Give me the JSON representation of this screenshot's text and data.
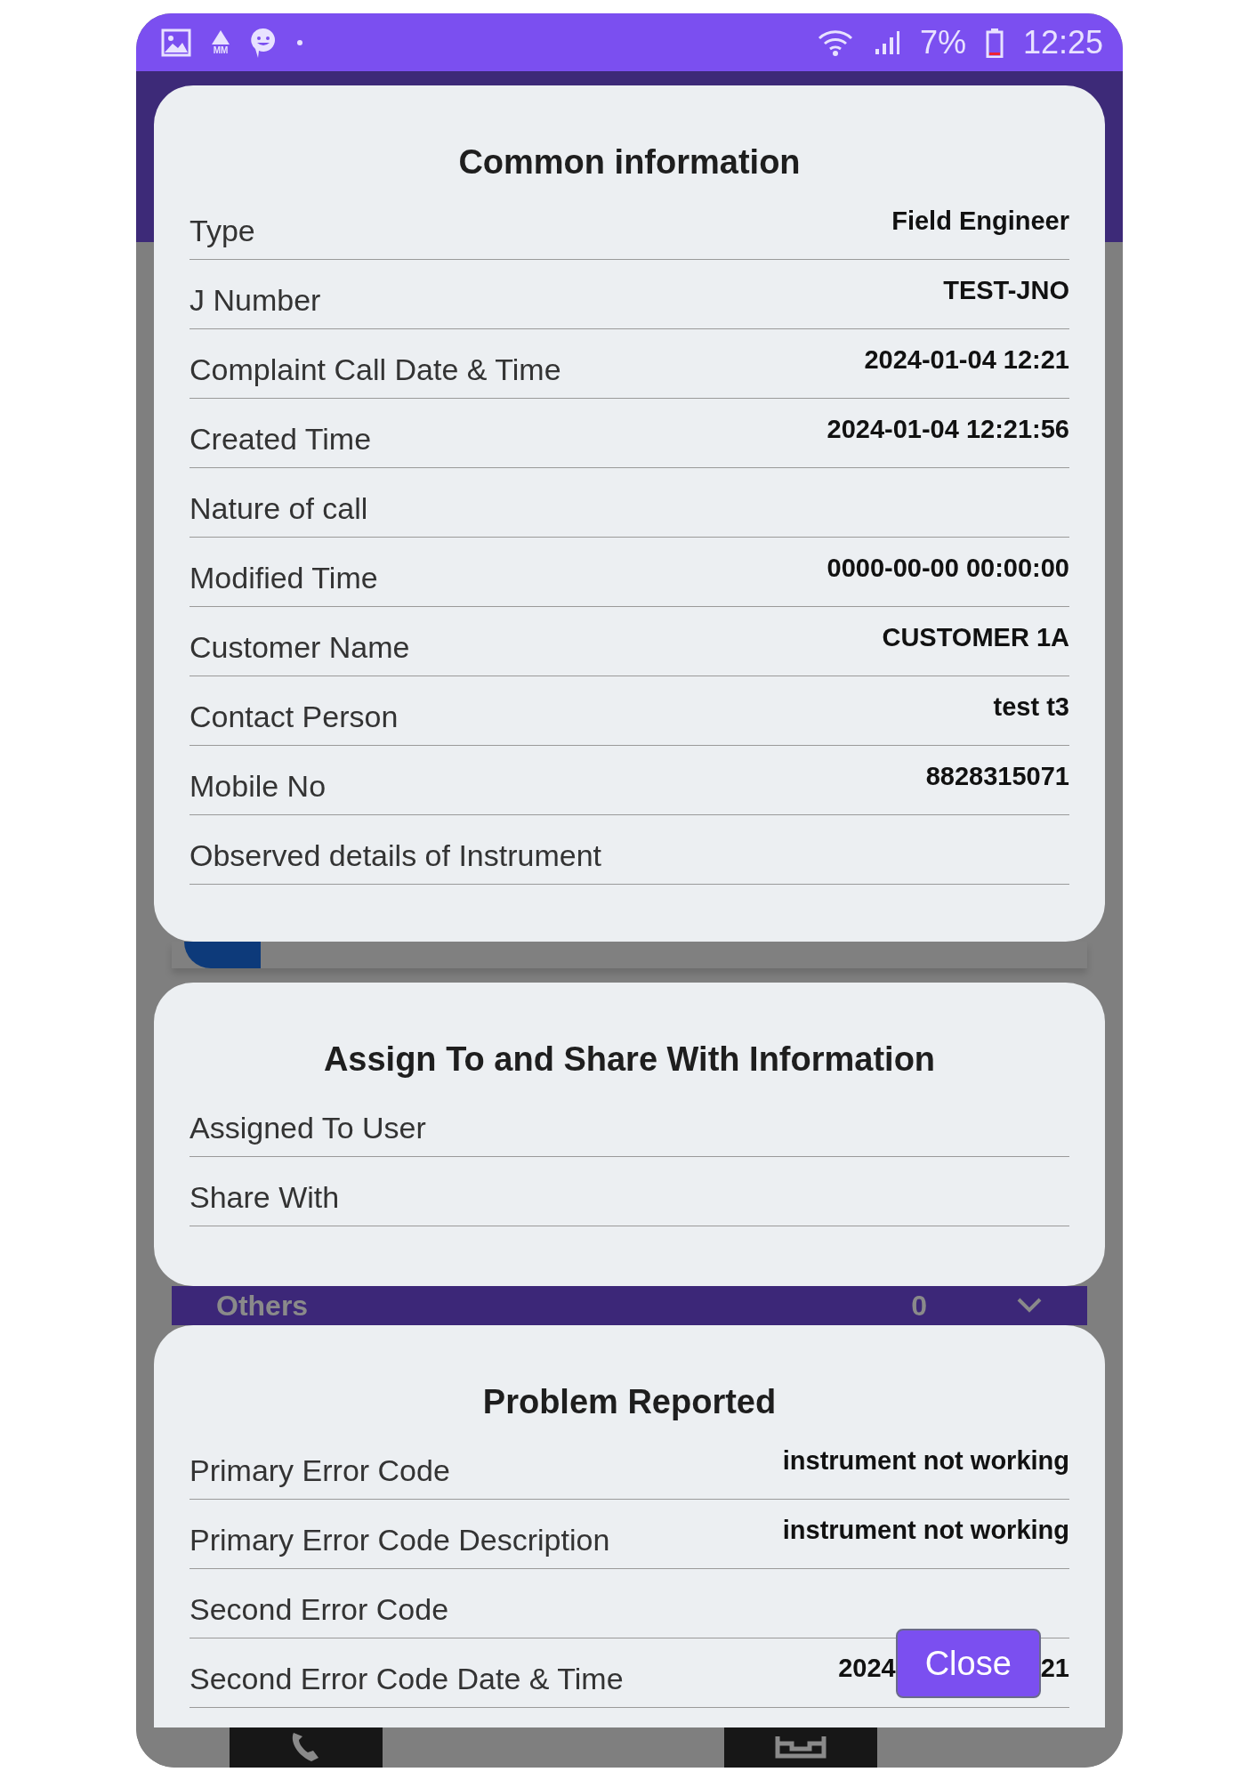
{
  "status_bar": {
    "notification_badge": "MM",
    "battery": "7%",
    "time": "12:25"
  },
  "background": {
    "list_label": "Others",
    "list_count": "0"
  },
  "sections": [
    {
      "title": "Common information",
      "rows": [
        {
          "label": "Type",
          "value": "Field Engineer"
        },
        {
          "label": "J Number",
          "value": "TEST-JNO"
        },
        {
          "label": "Complaint Call Date & Time",
          "value": "2024-01-04 12:21"
        },
        {
          "label": "Created Time",
          "value": "2024-01-04 12:21:56"
        },
        {
          "label": "Nature of call"
        },
        {
          "label": "Modified Time",
          "value": "0000-00-00 00:00:00"
        },
        {
          "label": "Customer Name",
          "value": "CUSTOMER 1A"
        },
        {
          "label": "Contact Person",
          "value": "test t3"
        },
        {
          "label": "Mobile No",
          "value": "8828315071"
        },
        {
          "label": "Observed details of Instrument"
        }
      ]
    },
    {
      "title": "Assign To and Share With Information",
      "rows": [
        {
          "label": "Assigned To User"
        },
        {
          "label": "Share With"
        }
      ]
    },
    {
      "title": "Problem Reported",
      "rows": [
        {
          "label": "Primary Error Code",
          "value": "instrument not working"
        },
        {
          "label": "Primary Error Code Description",
          "value": "instrument not working"
        },
        {
          "label": "Second Error Code"
        },
        {
          "label": "Second Error Code Date & Time",
          "value_start": "2024",
          "value_end": "21"
        }
      ]
    }
  ],
  "close_button": "Close"
}
